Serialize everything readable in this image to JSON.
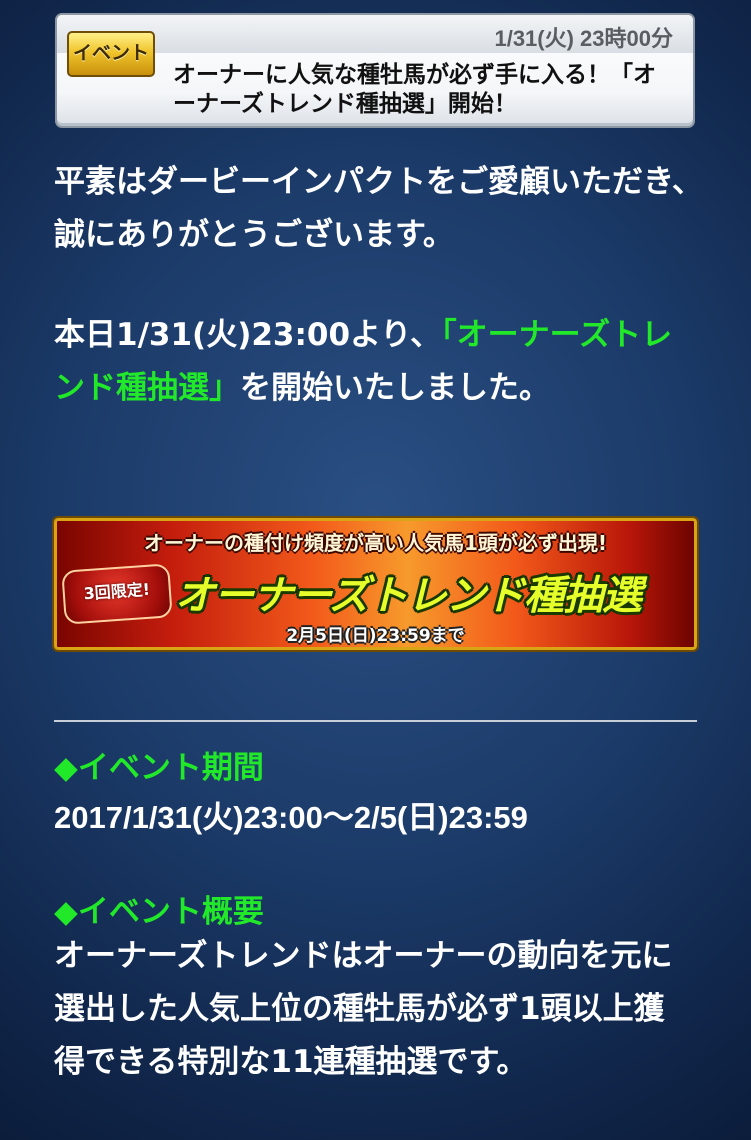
{
  "header": {
    "date": "1/31(火) 23時00分",
    "badge_label": "イベント",
    "title": "オーナーに人気な種牡馬が必ず手に入る！「オーナーズトレンド種抽選」開始！"
  },
  "intro": {
    "greeting": "平素はダービーインパクトをご愛顧いただき、誠にありがとうございます。",
    "announce_prefix": "本日1/31(火)23:00より、",
    "announce_highlight": "「オーナーズトレンド種抽選」",
    "announce_suffix": "を開始いたしました。"
  },
  "banner": {
    "top_text": "オーナーの種付け頻度が高い人気馬1頭が必ず出現!",
    "limit_badge": "3回限定!",
    "title": "オーナーズトレンド種抽選",
    "deadline": "2月5日(日)23:59まで"
  },
  "event_period": {
    "heading": "◆イベント期間",
    "value": "2017/1/31(火)23:00〜2/5(日)23:59"
  },
  "event_overview": {
    "heading": "◆イベント概要",
    "text": "オーナーズトレンドはオーナーの動向を元に選出した人気上位の種牡馬が必ず1頭以上獲得できる特別な11連種抽選です。"
  },
  "colors": {
    "highlight_green": "#22e82a",
    "background_navy": "#1b3a68",
    "badge_gold": "#f0c52d"
  }
}
